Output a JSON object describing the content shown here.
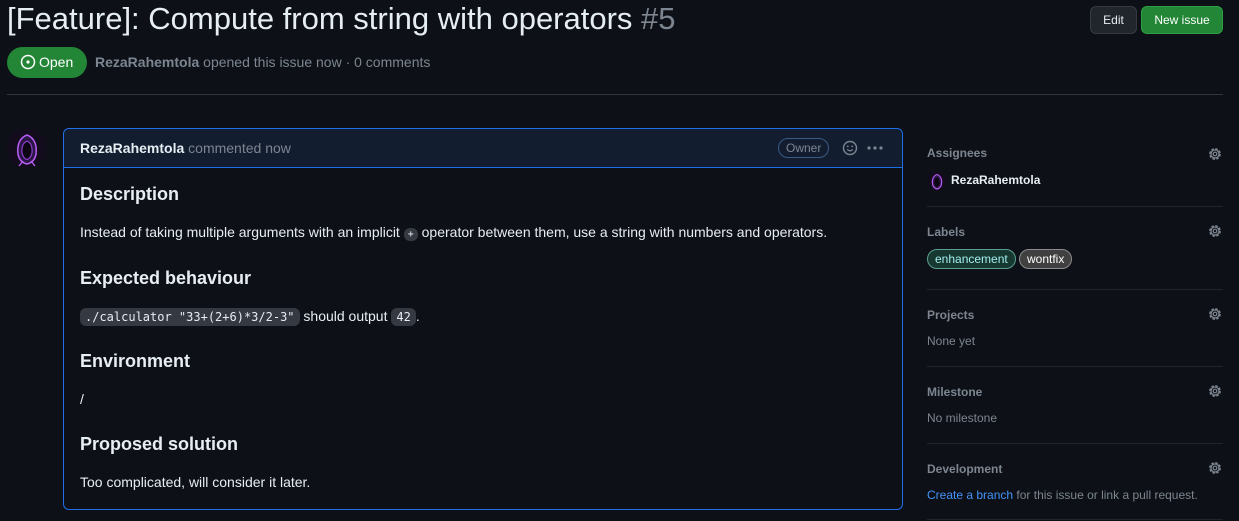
{
  "issue": {
    "title": "[Feature]: Compute from string with operators",
    "number": "#5",
    "state": "Open",
    "author": "RezaRahemtola",
    "meta_rest": "opened this issue now · 0 comments"
  },
  "header_buttons": {
    "edit": "Edit",
    "new_issue": "New issue"
  },
  "comment": {
    "author": "RezaRahemtola",
    "time": "commented now",
    "role_badge": "Owner",
    "body": {
      "h_description": "Description",
      "p_description_1": "Instead of taking multiple arguments with an implicit",
      "code_plus": "+",
      "p_description_2": "operator between them, use a string with numbers and operators.",
      "h_expected": "Expected behaviour",
      "code_command": "./calculator \"33+(2+6)*3/2-3\"",
      "p_expected_mid": "should output",
      "code_result": "42",
      "p_expected_end": ".",
      "h_environment": "Environment",
      "p_environment": "/",
      "h_solution": "Proposed solution",
      "p_solution": "Too complicated, will consider it later."
    }
  },
  "sidebar": {
    "assignees": {
      "heading": "Assignees",
      "user": "RezaRahemtola"
    },
    "labels": {
      "heading": "Labels",
      "items": [
        {
          "name": "enhancement",
          "color": "#a2eeef"
        },
        {
          "name": "wontfix",
          "color": "#ffffff"
        }
      ]
    },
    "projects": {
      "heading": "Projects",
      "value": "None yet"
    },
    "milestone": {
      "heading": "Milestone",
      "value": "No milestone"
    },
    "development": {
      "heading": "Development",
      "link": "Create a branch",
      "rest": "for this issue or link a pull request."
    }
  },
  "colors": {
    "background": "#0d1117",
    "open_green": "#238636",
    "accent_blue": "#1f6feb",
    "link_blue": "#4493f8",
    "muted": "#7d8590"
  }
}
